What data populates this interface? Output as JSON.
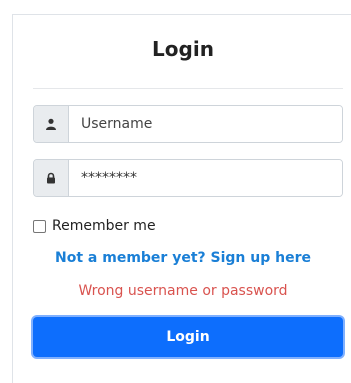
{
  "login": {
    "title": "Login",
    "username_placeholder": "Username",
    "password_value": "********",
    "remember_label": "Remember me",
    "signup_link": "Not a member yet? Sign up here",
    "error_message": "Wrong username or password",
    "submit_label": "Login"
  },
  "icons": {
    "username": "user-icon",
    "password": "lock-icon"
  },
  "colors": {
    "primary": "#0d6efd",
    "link": "#1a7fd6",
    "error": "#d9534f"
  }
}
